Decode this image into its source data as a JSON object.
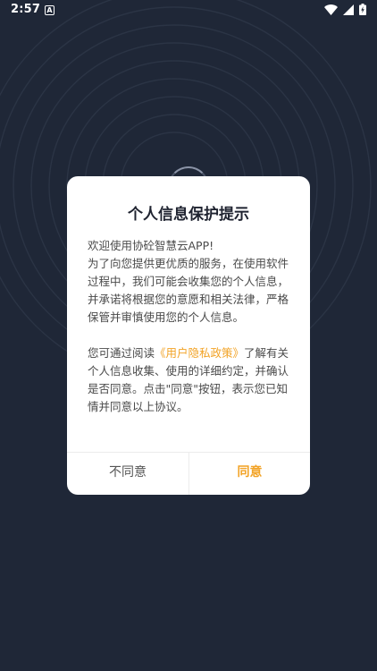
{
  "status_bar": {
    "time": "2:57",
    "notification_letter": "A",
    "icons": [
      "wifi-icon",
      "signal-icon",
      "battery-charging-icon"
    ]
  },
  "colors": {
    "background": "#1f2737",
    "dialog_background": "#ffffff",
    "accent": "#f2a326",
    "title": "#1f2330",
    "body_text": "#4a4a4a"
  },
  "dialog": {
    "title": "个人信息保护提示",
    "welcome": "欢迎使用协砼智慧云APP!",
    "intro": "为了向您提供更优质的服务，在使用软件过程中，我们可能会收集您的个人信息，并承诺将根据您的意愿和相关法律，严格保管并审慎使用您的个人信息。",
    "read_prefix": "您可通过阅读",
    "policy_link": "《用户隐私政策》",
    "read_suffix": "了解有关个人信息收集、使用的详细约定，并确认是否同意。点击\"同意\"按钮，表示您已知情并同意以上协议。",
    "disagree_label": "不同意",
    "agree_label": "同意"
  }
}
